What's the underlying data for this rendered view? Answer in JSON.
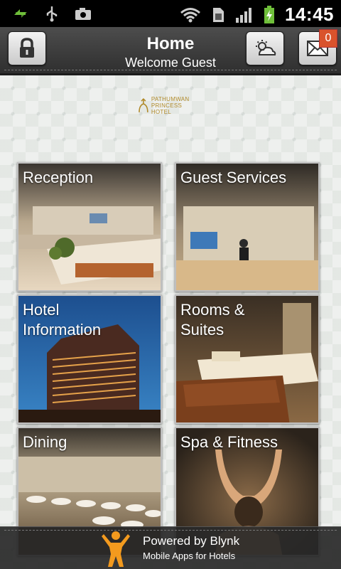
{
  "status_bar": {
    "time": "14:45",
    "icons": [
      "usb-sync-icon",
      "usb-icon",
      "camera-icon",
      "wifi-icon",
      "sim-icon",
      "signal-icon",
      "battery-charging-icon"
    ]
  },
  "header": {
    "title": "Home",
    "subtitle": "Welcome Guest",
    "buttons": {
      "lock": "lock-icon",
      "weather": "weather-icon",
      "mail": "mail-icon"
    },
    "mail_badge": "0"
  },
  "logo": {
    "line1": "PATHUMWAN",
    "line2": "PRINCESS HOTEL"
  },
  "tiles": [
    {
      "label_lines": [
        "Reception"
      ]
    },
    {
      "label_lines": [
        "Guest Services"
      ]
    },
    {
      "label_lines": [
        "Hotel",
        "Information"
      ]
    },
    {
      "label_lines": [
        "Rooms &",
        "Suites"
      ]
    },
    {
      "label_lines": [
        "Dining"
      ]
    },
    {
      "label_lines": [
        "Spa & Fitness"
      ]
    }
  ],
  "footer": {
    "line1": "Powered by Blynk",
    "line2": "Mobile Apps for Hotels"
  }
}
